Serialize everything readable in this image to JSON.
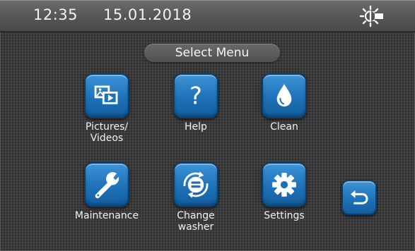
{
  "status_bar": {
    "time": "12:35",
    "date": "15.01.2018",
    "brightness_icon": "sun-icon"
  },
  "title": "Select Menu",
  "menu": [
    {
      "id": "pictures-videos",
      "label": "Pictures/\nVideos",
      "icon": "pictures-videos-icon"
    },
    {
      "id": "help",
      "label": "Help",
      "icon": "question-mark-icon"
    },
    {
      "id": "clean",
      "label": "Clean",
      "icon": "water-drop-icon"
    },
    {
      "id": "maintenance",
      "label": "Maintenance",
      "icon": "wrench-icon"
    },
    {
      "id": "change-washer",
      "label": "Change\nwasher",
      "icon": "rotate-washer-icon"
    },
    {
      "id": "settings",
      "label": "Settings",
      "icon": "gear-icon"
    }
  ],
  "back_button": {
    "icon": "back-arrow-icon"
  },
  "colors": {
    "button_blue": "#1e72b9",
    "background": "#3b3b3b",
    "status_bar": "#555555",
    "text": "#f2f2f2"
  }
}
